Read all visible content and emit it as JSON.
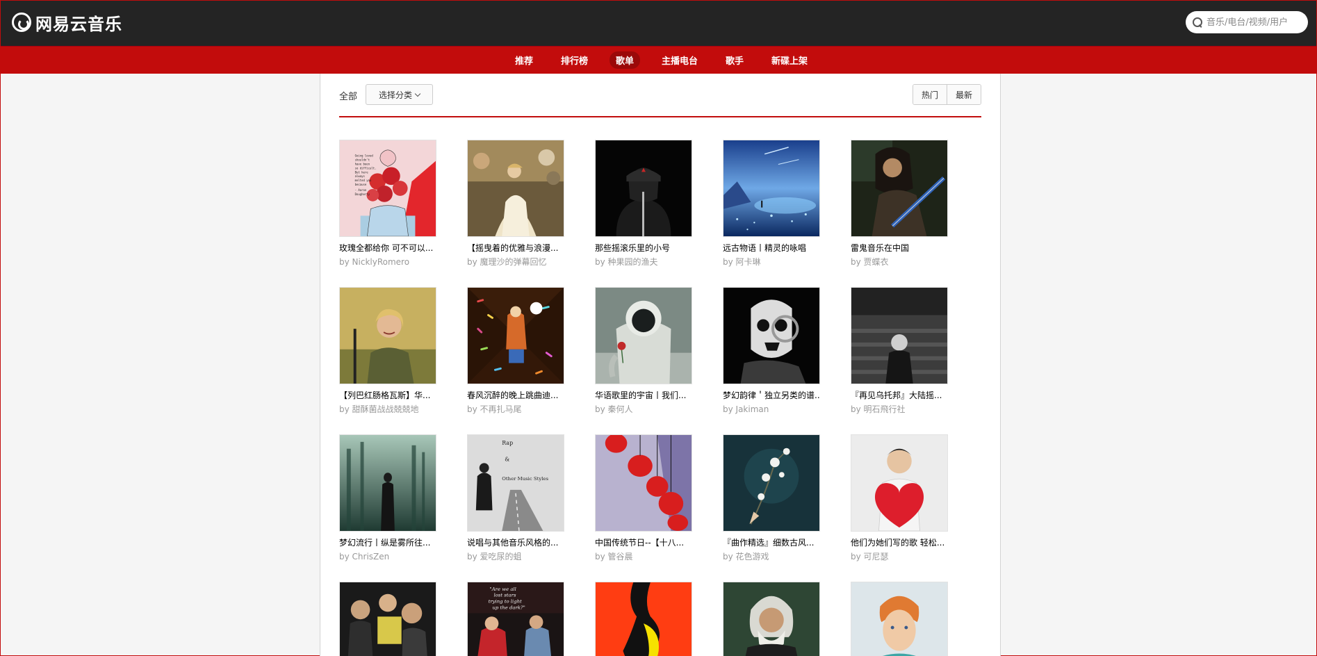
{
  "header": {
    "logo_text": "网易云音乐",
    "search_placeholder": "音乐/电台/视频/用户"
  },
  "nav": [
    "推荐",
    "排行榜",
    "歌单",
    "主播电台",
    "歌手",
    "新碟上架"
  ],
  "nav_active": "歌单",
  "filters": {
    "all_label": "全部",
    "category_label": "选择分类",
    "sort_hot": "热门",
    "sort_new": "最新"
  },
  "playlists": [
    {
      "title": "玫瑰全都给你 可不可以...",
      "by": "by NicklyRomero"
    },
    {
      "title": "【摇曳着的优雅与浪漫...",
      "by": "by 魔理沙的弹幕回忆"
    },
    {
      "title": "那些摇滚乐里的小号",
      "by": "by 种果园的渔夫"
    },
    {
      "title": "远古物语丨精灵的咏唱",
      "by": "by 阿卡琳"
    },
    {
      "title": "雷鬼音乐在中国",
      "by": "by 贾蝶衣"
    },
    {
      "title": "【列巴红肠格瓦斯】华...",
      "by": "by 甜酥菌战战兢兢地"
    },
    {
      "title": "春风沉醉的晚上跳曲迪...",
      "by": "by 不再扎马尾"
    },
    {
      "title": "华语歌里的宇宙丨我们...",
      "by": "by 秦何人"
    },
    {
      "title": "梦幻韵律＇独立另类的谱...",
      "by": "by Jakiman"
    },
    {
      "title": "『再见乌托邦』大陆摇...",
      "by": "by 明石飛行社"
    },
    {
      "title": "梦幻流行丨纵是雾所往...",
      "by": "by ChrisZen"
    },
    {
      "title": "说唱与其他音乐风格的...",
      "by": "by 爱吃尿的蛆"
    },
    {
      "title": "中国传统节日--【十八...",
      "by": "by 管谷晨"
    },
    {
      "title": "『曲作精选』细数古风...",
      "by": "by 花色游戏"
    },
    {
      "title": "他们为她们写的歌 轻松...",
      "by": "by 可尼瑟"
    },
    {
      "title": "",
      "by": ""
    },
    {
      "title": "",
      "by": ""
    },
    {
      "title": "",
      "by": ""
    },
    {
      "title": "",
      "by": ""
    },
    {
      "title": "",
      "by": ""
    }
  ],
  "cover_texts": {
    "c0": [
      "Going loved",
      "shouldn't",
      "have been",
      "so difficult.",
      "But here",
      "always",
      "melted you",
      "because",
      "- Aaron",
      "Dougherty"
    ],
    "c11": [
      "Rap",
      "&",
      "Other Music Styles"
    ],
    "c16": [
      "\"Are we all",
      "lost stars",
      "trying to light",
      "up the dark?\""
    ]
  },
  "colors": {
    "brand_red": "#c20c0c",
    "topbar": "#242424",
    "active_nav": "#9b0909"
  }
}
